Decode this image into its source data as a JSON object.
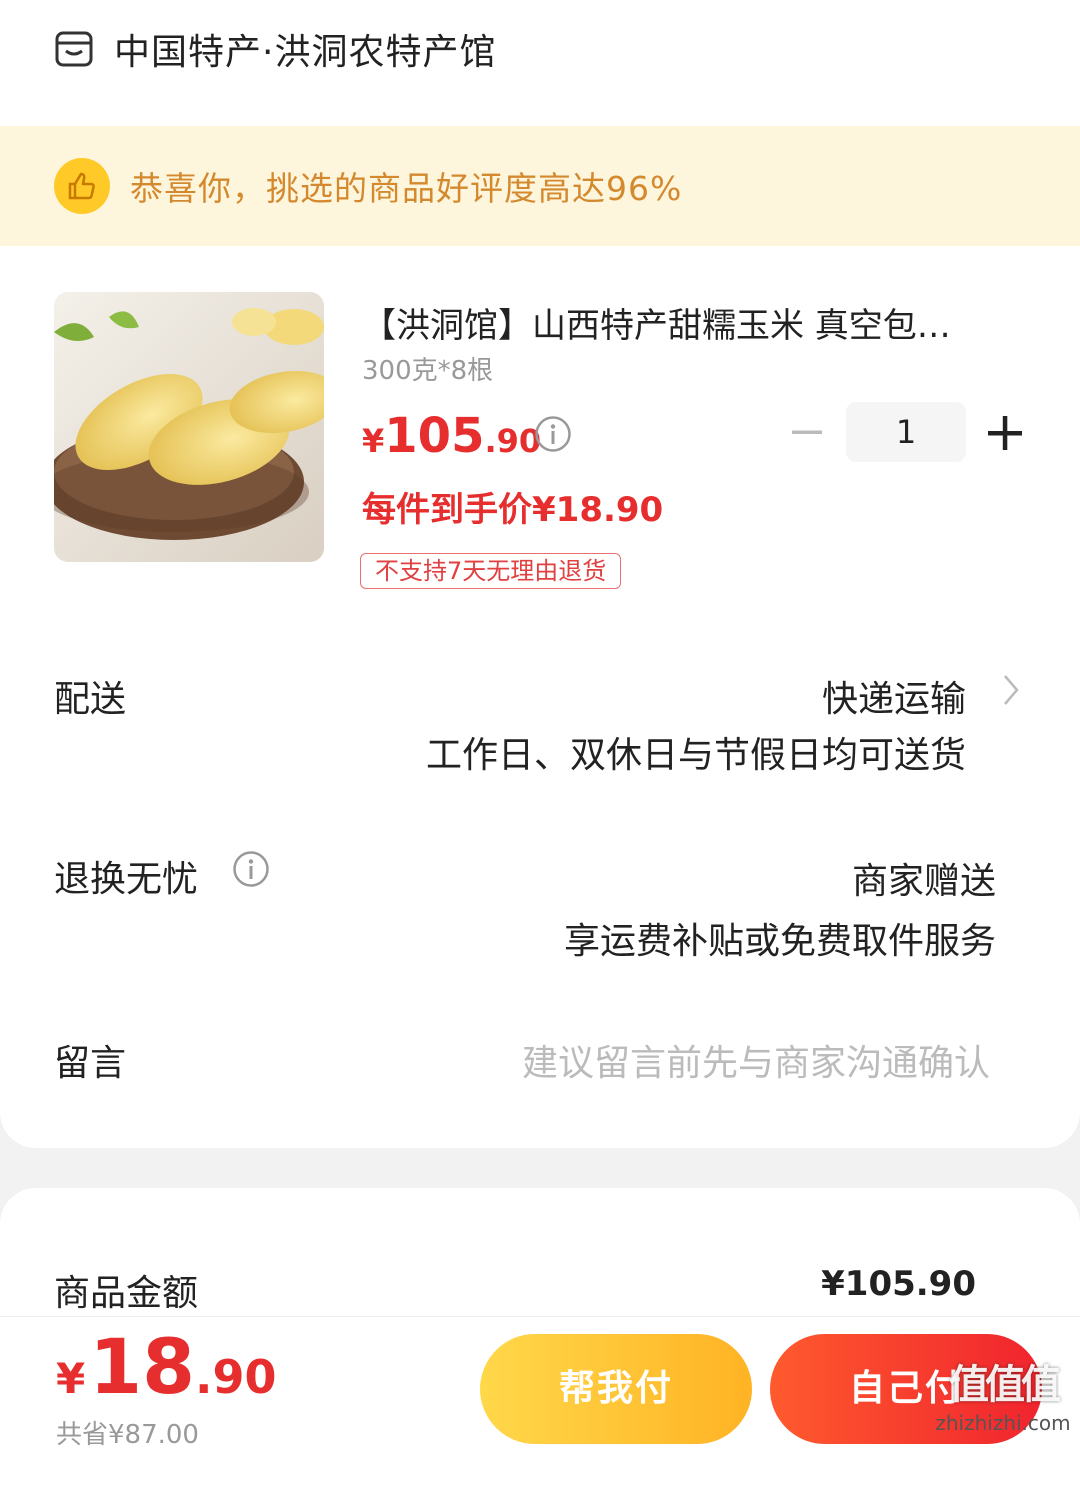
{
  "shop": {
    "name": "中国特产·洪洞农特产馆",
    "icon": "shop-icon"
  },
  "praise": {
    "text": "恭喜你，挑选的商品好评度高达96%",
    "icon": "thumbs-up-icon",
    "bg": "#fdf6dc",
    "color": "#d4892e"
  },
  "product": {
    "title": "【洪洞馆】山西特产甜糯玉米 真空包…",
    "spec": "300克*8根",
    "price_yen": "¥",
    "price_int": "105",
    "price_dec": ".90",
    "deal_price": "每件到手价¥18.90",
    "tag": "不支持7天无理由退货",
    "quantity": "1"
  },
  "delivery": {
    "label": "配送",
    "method": "快递运输",
    "note": "工作日、双休日与节假日均可送货"
  },
  "returns": {
    "label": "退换无忧",
    "value": "商家赠送",
    "note": "享运费补贴或免费取件服务"
  },
  "remark": {
    "label": "留言",
    "placeholder": "建议留言前先与商家沟通确认"
  },
  "summary": {
    "amount_label": "商品金额",
    "amount_value": "¥105.90"
  },
  "checkout": {
    "total_yen": "¥",
    "total_int": "18",
    "total_dec": ".90",
    "saved": "共省¥87.00",
    "help_pay_label": "帮我付",
    "self_pay_label": "自己付"
  },
  "watermark": {
    "main": "值值值",
    "sub": "zhizhizhi.com"
  },
  "colors": {
    "accent": "#e62e2e",
    "help_btn": "#ffc12e",
    "self_btn": "#f5322e"
  }
}
